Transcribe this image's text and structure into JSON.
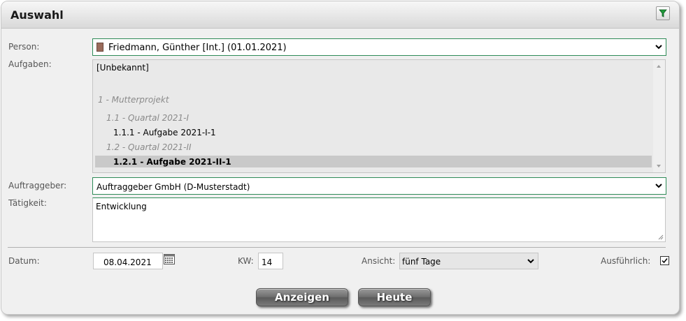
{
  "panel": {
    "title": "Auswahl",
    "filter_icon": "filter-icon"
  },
  "person": {
    "label": "Person:",
    "value": "Friedmann, Günther [Int.] (01.01.2021)"
  },
  "aufgaben": {
    "label": "Aufgaben:",
    "items": [
      {
        "text": "[Unbekannt]",
        "style": "normal"
      },
      {
        "text": "1 - Mutterprojekt",
        "style": "group"
      },
      {
        "text": "1.1 - Quartal 2021-I",
        "style": "group"
      },
      {
        "text": "1.1.1 - Aufgabe 2021-I-1",
        "style": "normal"
      },
      {
        "text": "1.2 - Quartal 2021-II",
        "style": "group"
      },
      {
        "text": "1.2.1 - Aufgabe 2021-II-1",
        "style": "selected"
      }
    ]
  },
  "auftraggeber": {
    "label": "Auftraggeber:",
    "value": "Auftraggeber GmbH (D-Musterstadt)"
  },
  "taetigkeit": {
    "label": "Tätigkeit:",
    "value": "Entwicklung"
  },
  "datum": {
    "label": "Datum:",
    "value": "08.04.2021"
  },
  "kw": {
    "label": "KW:",
    "value": "14"
  },
  "ansicht": {
    "label": "Ansicht:",
    "value": "fünf Tage"
  },
  "ausfuehrlich": {
    "label": "Ausführlich:",
    "checked": true
  },
  "buttons": {
    "anzeigen": "Anzeigen",
    "heute": "Heute"
  }
}
